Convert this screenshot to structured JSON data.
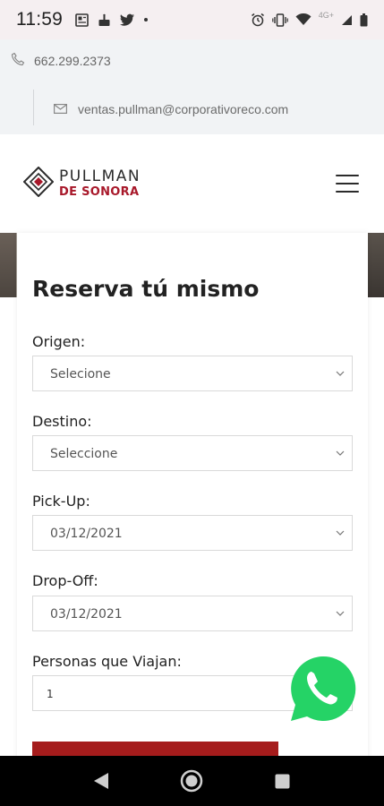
{
  "status_bar": {
    "time": "11:59",
    "network_label": "4G+",
    "left_icons": [
      "news-icon",
      "cake-icon",
      "twitter-icon",
      "dot-icon"
    ],
    "right_icons": [
      "alarm-icon",
      "vibrate-icon",
      "wifi-icon",
      "signal-icon",
      "battery-icon"
    ]
  },
  "contact": {
    "phone": "662.299.2373",
    "email": "ventas.pullman@corporativoreco.com"
  },
  "brand": {
    "line1": "PULLMAN",
    "line2": "DE SONORA",
    "accent_color": "#a8182a"
  },
  "form": {
    "title": "Reserva tú mismo",
    "origen_label": "Origen:",
    "origen_value": "Selecione",
    "destino_label": "Destino:",
    "destino_value": "Seleccione",
    "pickup_label": "Pick-Up:",
    "pickup_value": "03/12/2021",
    "dropoff_label": "Drop-Off:",
    "dropoff_value": "03/12/2021",
    "personas_label": "Personas que Viajan:",
    "personas_value": "1",
    "button_color": "#a51c1c"
  },
  "floating": {
    "whatsapp_color": "#25d366"
  },
  "android_nav": [
    "back-icon",
    "home-icon",
    "recents-icon"
  ]
}
